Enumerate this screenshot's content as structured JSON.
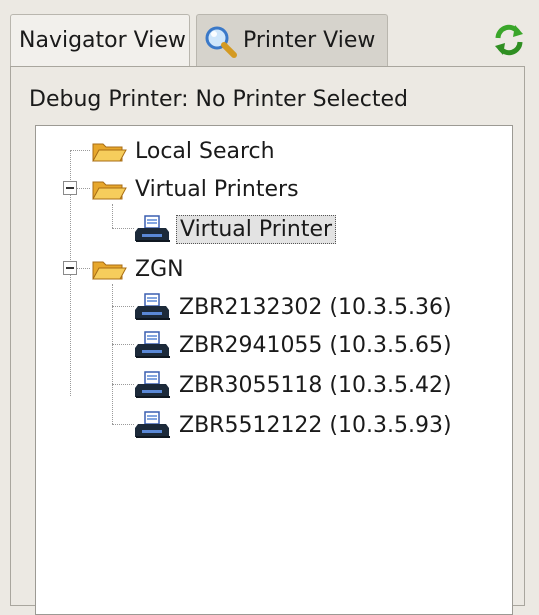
{
  "tabs": [
    {
      "label": "Navigator View",
      "icon": "none",
      "active": false
    },
    {
      "label": "Printer View",
      "icon": "magnifier-icon",
      "active": true
    }
  ],
  "toolbar": {
    "refresh_icon": "refresh-icon"
  },
  "panel": {
    "debug_label": "Debug Printer: No Printer Selected"
  },
  "tree": {
    "local_search": {
      "label": "Local Search",
      "icon": "folder-open-icon"
    },
    "virtual_printers": {
      "label": "Virtual Printers",
      "icon": "folder-open-icon",
      "expanded": true,
      "children": [
        {
          "label": "Virtual Printer",
          "icon": "printer-icon",
          "selected": true
        }
      ]
    },
    "zgn": {
      "label": "ZGN",
      "icon": "folder-open-icon",
      "expanded": true,
      "children": [
        {
          "label": "ZBR2132302 (10.3.5.36)",
          "icon": "printer-icon"
        },
        {
          "label": "ZBR2941055 (10.3.5.65)",
          "icon": "printer-icon"
        },
        {
          "label": "ZBR3055118 (10.3.5.42)",
          "icon": "printer-icon"
        },
        {
          "label": "ZBR5512122 (10.3.5.93)",
          "icon": "printer-icon"
        }
      ]
    }
  },
  "colors": {
    "folder": "#f4c54a",
    "printer_body": "#1c2a3a",
    "paper_blue": "#5a88d6",
    "refresh_green": "#3aa62a"
  }
}
